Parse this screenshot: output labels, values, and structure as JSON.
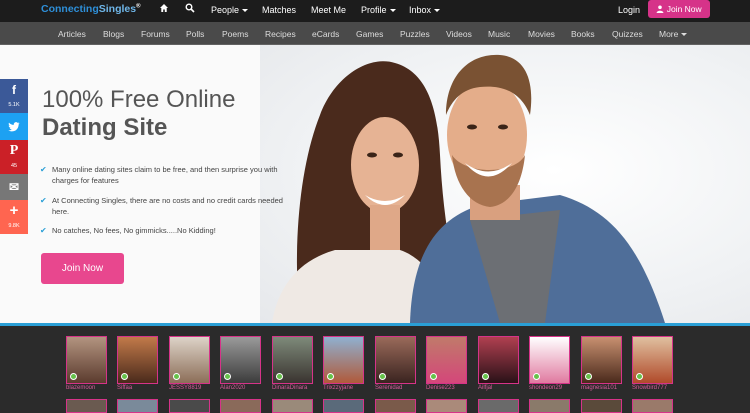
{
  "topbar": {
    "logo_part1": "Connecting",
    "logo_part2": "Singles",
    "logo_mark": "®",
    "home_icon": "home-icon",
    "search_icon": "search-icon",
    "nav": [
      {
        "label": "People",
        "dropdown": true
      },
      {
        "label": "Matches",
        "dropdown": false
      },
      {
        "label": "Meet Me",
        "dropdown": false
      },
      {
        "label": "Profile",
        "dropdown": true
      },
      {
        "label": "Inbox",
        "dropdown": true
      }
    ],
    "login": "Login",
    "join": "Join Now"
  },
  "subnav": [
    "Articles",
    "Blogs",
    "Forums",
    "Polls",
    "Poems",
    "Recipes",
    "eCards",
    "Games",
    "Puzzles",
    "Videos",
    "Music",
    "Movies",
    "Books",
    "Quizzes",
    "More"
  ],
  "hero": {
    "title_line1": "100% Free Online",
    "title_line2": "Dating Site",
    "bullets": [
      "Many online dating sites claim to be free, and then surprise you with charges for features",
      "At Connecting Singles, there are no costs and no credit cards needed here.",
      "No catches, No fees, No gimmicks.....No Kidding!"
    ],
    "join": "Join Now"
  },
  "social": [
    {
      "icon": "facebook-icon",
      "glyph": "f",
      "count": "5.1K",
      "color": "#3b5998"
    },
    {
      "icon": "twitter-icon",
      "glyph": "🐦",
      "count": "",
      "color": "#1da1f2"
    },
    {
      "icon": "pinterest-icon",
      "glyph": "P",
      "count": "45",
      "color": "#cb2027"
    },
    {
      "icon": "email-icon",
      "glyph": "✉",
      "count": "",
      "color": "#777777"
    },
    {
      "icon": "share-plus-icon",
      "glyph": "+",
      "count": "9.8K",
      "color": "#ff6550"
    }
  ],
  "members": [
    "blazemoon",
    "Siffaa",
    "JESSY8819",
    "Alan2020",
    "DinaraDinara",
    "Trixzzyjane",
    "Serenidad",
    "Denise223",
    "Ailfjal",
    "shondeon29",
    "magnesia101",
    "Snowbird777"
  ],
  "colors": {
    "brand_blue": "#2e8fd8",
    "pink": "#d63389",
    "accent": "#2a9fd6"
  }
}
